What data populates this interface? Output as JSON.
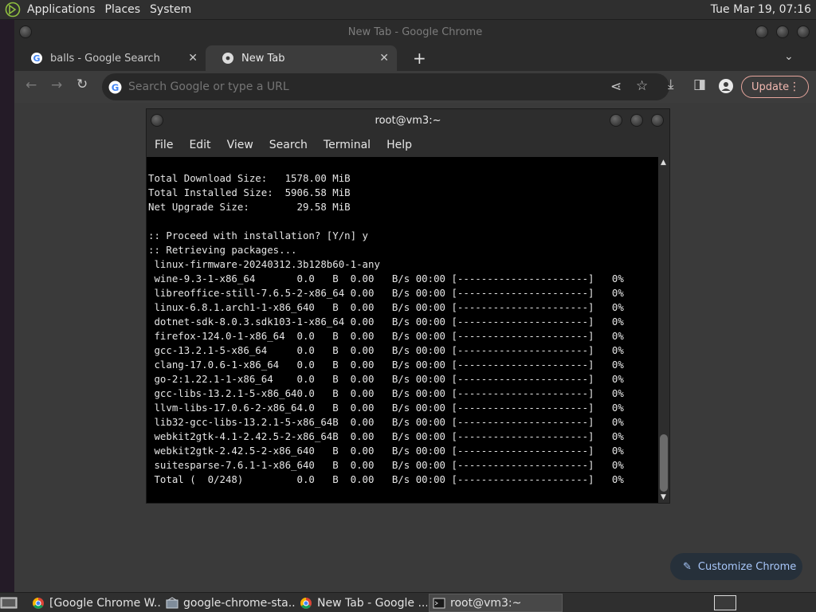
{
  "top_panel": {
    "menus": [
      "Applications",
      "Places",
      "System"
    ],
    "clock": "Tue Mar 19, 07:16"
  },
  "chrome": {
    "window_title": "New Tab - Google Chrome",
    "tabs": [
      {
        "label": "balls - Google Search",
        "close": "✕"
      },
      {
        "label": "New Tab",
        "close": "✕"
      }
    ],
    "new_tab": "+",
    "omnibox_placeholder": "Search Google or type a URL",
    "update_label": "Update",
    "customize_label": "Customize Chrome"
  },
  "terminal": {
    "title": "root@vm3:~",
    "menus": [
      "File",
      "Edit",
      "View",
      "Search",
      "Terminal",
      "Help"
    ],
    "output": "Total Download Size:   1578.00 MiB\nTotal Installed Size:  5906.58 MiB\nNet Upgrade Size:        29.58 MiB\n\n:: Proceed with installation? [Y/n] y\n:: Retrieving packages...\n linux-firmware-20240312.3b128b60-1-any\n wine-9.3-1-x86_64       0.0   B  0.00   B/s 00:00 [----------------------]   0%\n libreoffice-still-7.6.5-2-x86_64 0.00   B/s 00:00 [----------------------]   0%\n linux-6.8.1.arch1-1-x86_640   B  0.00   B/s 00:00 [----------------------]   0%\n dotnet-sdk-8.0.3.sdk103-1-x86_64 0.00   B/s 00:00 [----------------------]   0%\n firefox-124.0-1-x86_64  0.0   B  0.00   B/s 00:00 [----------------------]   0%\n gcc-13.2.1-5-x86_64     0.0   B  0.00   B/s 00:00 [----------------------]   0%\n clang-17.0.6-1-x86_64   0.0   B  0.00   B/s 00:00 [----------------------]   0%\n go-2:1.22.1-1-x86_64    0.0   B  0.00   B/s 00:00 [----------------------]   0%\n gcc-libs-13.2.1-5-x86_640.0   B  0.00   B/s 00:00 [----------------------]   0%\n llvm-libs-17.0.6-2-x86_64.0   B  0.00   B/s 00:00 [----------------------]   0%\n lib32-gcc-libs-13.2.1-5-x86_64B  0.00   B/s 00:00 [----------------------]   0%\n webkit2gtk-4.1-2.42.5-2-x86_64B  0.00   B/s 00:00 [----------------------]   0%\n webkit2gtk-2.42.5-2-x86_640   B  0.00   B/s 00:00 [----------------------]   0%\n suitesparse-7.6.1-1-x86_640   B  0.00   B/s 00:00 [----------------------]   0%\n Total (  0/248)         0.0   B  0.00   B/s 00:00 [----------------------]   0%"
  },
  "taskbar": {
    "tasks": [
      {
        "label": "[Google Chrome W..."
      },
      {
        "label": "google-chrome-sta..."
      },
      {
        "label": "New Tab - Google ..."
      },
      {
        "label": "root@vm3:~"
      }
    ]
  },
  "colors": {
    "update_accent": "#f2b8b0",
    "customize_accent": "#a8c7fa",
    "terminal_bg": "#000000"
  }
}
